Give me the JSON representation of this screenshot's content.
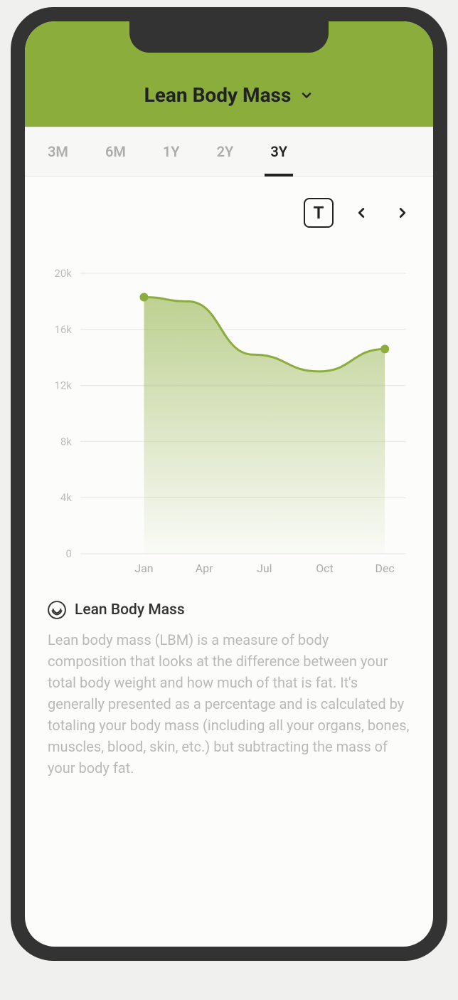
{
  "header": {
    "title": "Lean Body Mass"
  },
  "tabs": [
    {
      "label": "3M",
      "active": false
    },
    {
      "label": "6M",
      "active": false
    },
    {
      "label": "1Y",
      "active": false
    },
    {
      "label": "2Y",
      "active": false
    },
    {
      "label": "3Y",
      "active": true
    }
  ],
  "toolbar": {
    "mode_label": "T"
  },
  "chart_data": {
    "type": "area",
    "title": "",
    "xlabel": "",
    "ylabel": "",
    "ylim": [
      0,
      20000
    ],
    "y_ticks": [
      0,
      4000,
      8000,
      12000,
      16000,
      20000
    ],
    "y_tick_labels": [
      "0",
      "4k",
      "8k",
      "12k",
      "16k",
      "20k"
    ],
    "categories": [
      "Jan",
      "Apr",
      "Jul",
      "Oct",
      "Dec"
    ],
    "x": [
      "Jan",
      "Dec"
    ],
    "values": [
      18300,
      14600
    ],
    "series": [
      {
        "name": "Lean Body Mass",
        "values": [
          18300,
          14600
        ]
      }
    ],
    "curve_points": [
      {
        "x": "Jan",
        "y": 18300
      },
      {
        "x": "Mar",
        "y": 18000
      },
      {
        "x": "Jun",
        "y": 14200
      },
      {
        "x": "Sep",
        "y": 13000
      },
      {
        "x": "Dec",
        "y": 14600
      }
    ],
    "color": "#8aad3b"
  },
  "description": {
    "title": "Lean Body Mass",
    "body": "Lean body mass (LBM) is a measure of body composition that looks at the difference between your total body weight and how much of that is fat. It's generally presented as a percentage and is calculated by totaling your body mass (including all your organs, bones, muscles, blood, skin, etc.) but subtracting the mass of your body fat."
  }
}
